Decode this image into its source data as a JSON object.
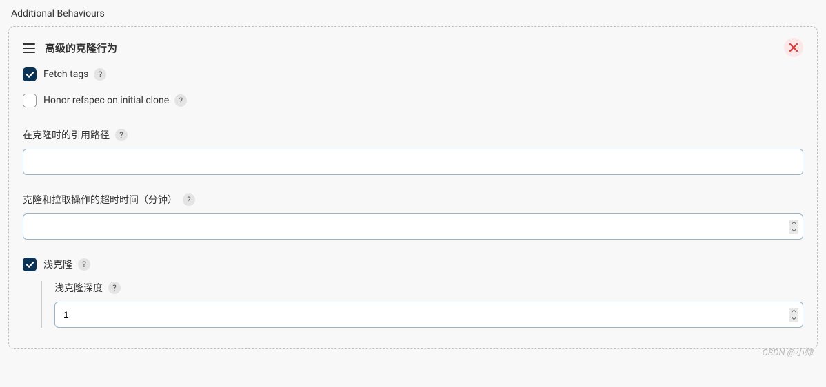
{
  "section": {
    "title": "Additional Behaviours"
  },
  "behaviour": {
    "header": "高级的克隆行为",
    "fetch_tags": {
      "label": "Fetch tags",
      "checked": true
    },
    "honor_refspec": {
      "label": "Honor refspec on initial clone",
      "checked": false
    },
    "reference_path": {
      "label": "在克隆时的引用路径",
      "value": ""
    },
    "timeout": {
      "label": "克隆和拉取操作的超时时间（分钟）",
      "value": ""
    },
    "shallow_clone": {
      "label": "浅克隆",
      "checked": true,
      "depth": {
        "label": "浅克隆深度",
        "value": "1"
      }
    }
  },
  "help_icon": "?",
  "watermark": "CSDN @小帅"
}
